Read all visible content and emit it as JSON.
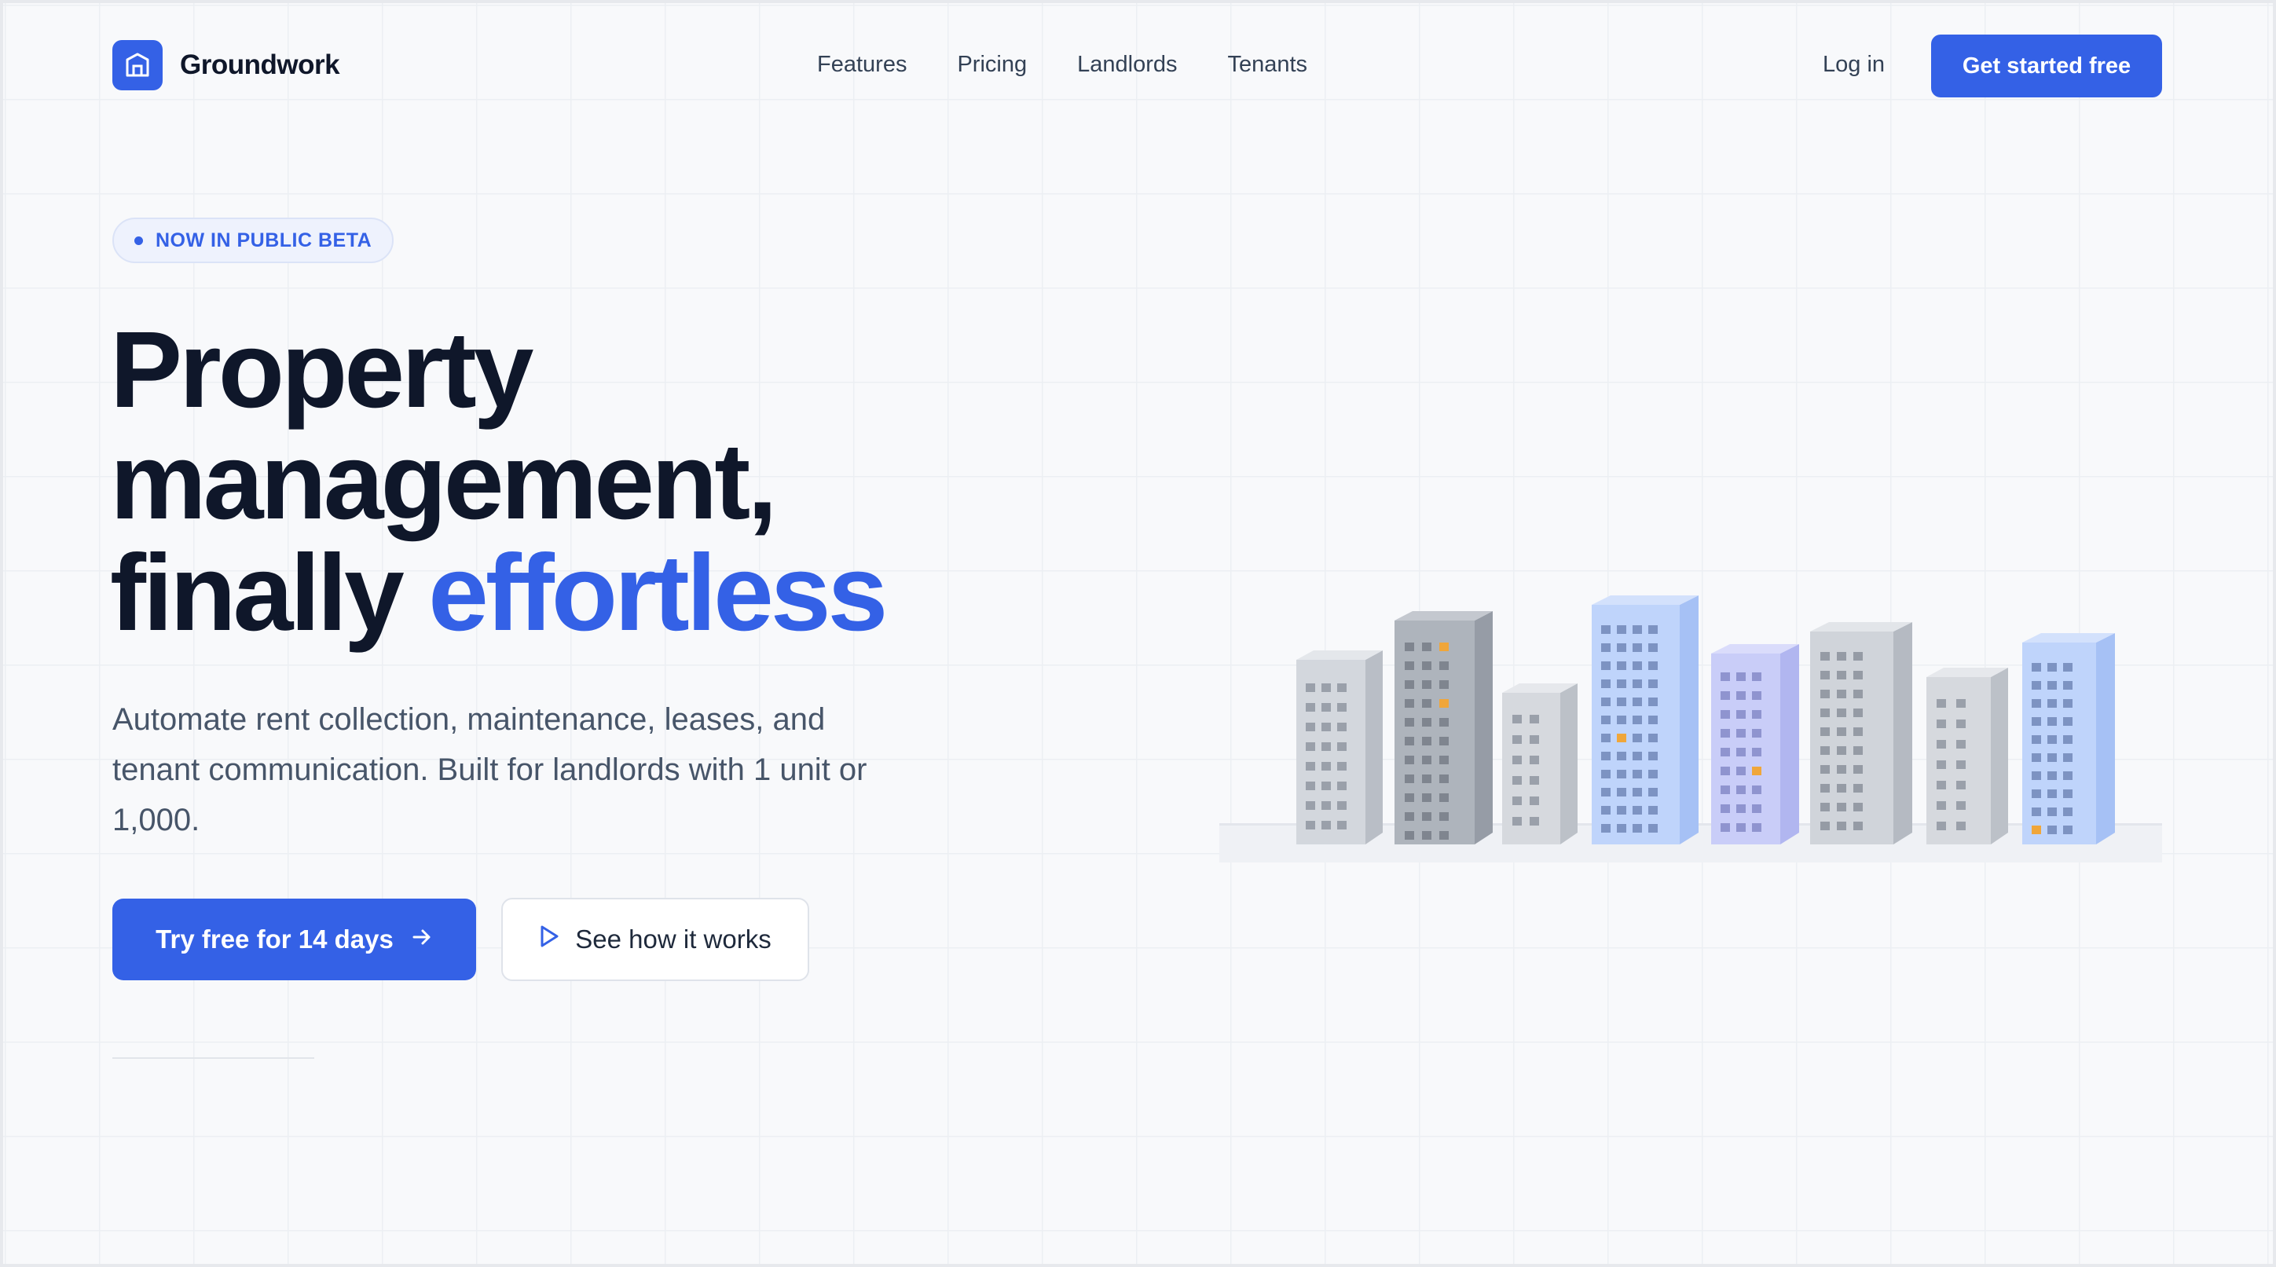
{
  "brand": {
    "name": "Groundwork",
    "logo_icon": "building-icon",
    "accent": "#3461e6"
  },
  "nav": {
    "links": [
      "Features",
      "Pricing",
      "Landlords",
      "Tenants"
    ],
    "login": "Log in",
    "cta": "Get started free"
  },
  "hero": {
    "badge": "NOW IN PUBLIC BETA",
    "headline_line1": "Property",
    "headline_line2": "management,",
    "headline_line3_plain": "finally ",
    "headline_line3_accent": "effortless",
    "subtitle": "Automate rent collection, maintenance, leases, and tenant communication. Built for landlords with 1 unit or 1,000.",
    "primary_cta": "Try free for 14 days",
    "secondary_cta": "See how it works"
  },
  "colors": {
    "heading": "#0f172a",
    "body": "#475569",
    "building_gray": "#d1d5db",
    "building_blue": "#bfd4fb",
    "building_lavender": "#c9cdf8",
    "window_lit": "#f0a63a"
  }
}
